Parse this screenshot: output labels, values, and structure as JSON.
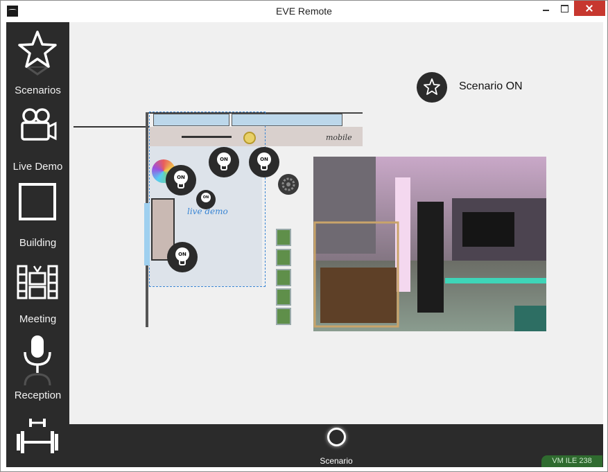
{
  "window": {
    "title": "EVE Remote",
    "icons": {
      "app": "eve-logo-icon",
      "minimize": "minimize-icon",
      "maximize": "maximize-icon",
      "close": "close-icon"
    }
  },
  "sidebar": {
    "items": [
      {
        "label": "Scenarios",
        "icon": "star-icon"
      },
      {
        "label": "Live Demo",
        "icon": "video-camera-icon"
      },
      {
        "label": "Building",
        "icon": "square-building-icon"
      },
      {
        "label": "Meeting",
        "icon": "media-wall-icon"
      },
      {
        "label": "Reception",
        "icon": "microphone-icon"
      },
      {
        "label": "",
        "icon": "dumbbell-icon"
      }
    ]
  },
  "main": {
    "scenario_status": {
      "text": "Scenario ON",
      "icon": "star-icon"
    },
    "floorplan": {
      "mobile_label": "mobile",
      "live_demo_label": "live demo",
      "lights": [
        {
          "label": "ON"
        },
        {
          "label": "ON"
        },
        {
          "label": "ON"
        },
        {
          "label": "ON"
        },
        {
          "label": "ON"
        }
      ],
      "icons": [
        "color-wheel-icon",
        "gear-icon",
        "plant-icon",
        "lamp-icon"
      ]
    },
    "camera_feed": {
      "icon": "live-camera-feed"
    }
  },
  "bottombar": {
    "scenario_label": "Scenario",
    "vm_badge": "VM ILE 238"
  },
  "colors": {
    "sidebar_bg": "#2b2b2b",
    "content_bg": "#f0f0f0",
    "accent_blue": "#3a86d4",
    "close_red": "#c7372f",
    "badge_green": "#2f6b2f"
  }
}
